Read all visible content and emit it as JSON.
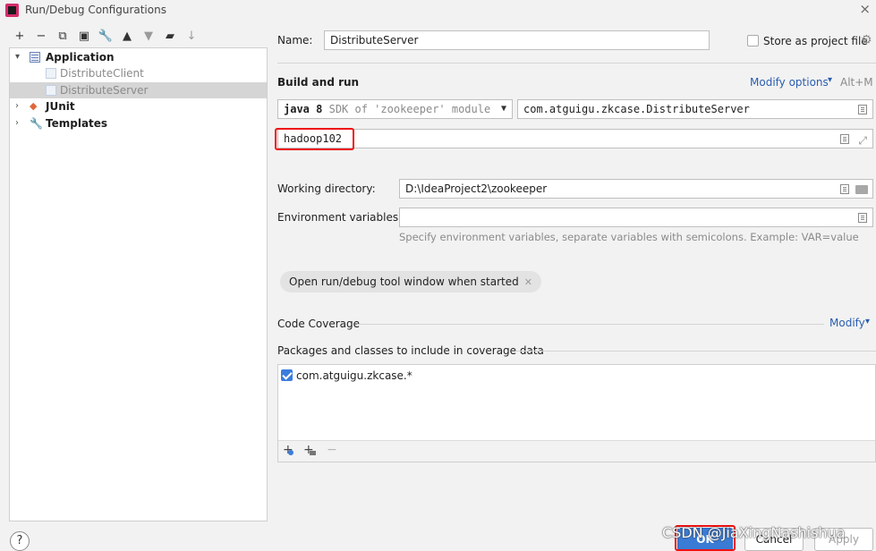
{
  "window": {
    "title": "Run/Debug Configurations",
    "close": "×"
  },
  "toolbar": {
    "add": "+",
    "remove": "−",
    "copy": "⧉",
    "save": "▣",
    "edit": "🔧",
    "up": "▲",
    "down": "▼",
    "folder": "▰",
    "sort": "↓"
  },
  "tree": {
    "application": "Application",
    "client": "DistributeClient",
    "server": "DistributeServer",
    "junit": "JUnit",
    "templates": "Templates"
  },
  "form": {
    "name_label": "Name:",
    "name_value": "DistributeServer",
    "store_label": "Store as project file",
    "build_run": "Build and run",
    "modify_options": "Modify options",
    "modify_shortcut": "Alt+M",
    "sdk_bold": "java 8",
    "sdk_rest": "SDK of 'zookeeper' module",
    "main_class": "com.atguigu.zkcase.DistributeServer",
    "program_args": "hadoop102",
    "working_dir_label": "Working directory:",
    "working_dir_value": "D:\\IdeaProject2\\zookeeper",
    "env_label": "Environment variables:",
    "env_hint": "Specify environment variables, separate variables with semicolons. Example: VAR=value",
    "chip": "Open run/debug tool window when started",
    "code_coverage": "Code Coverage",
    "modify": "Modify",
    "packages_label": "Packages and classes to include in coverage data",
    "package_item": "com.atguigu.zkcase.*"
  },
  "footer": {
    "help": "?",
    "ok": "OK",
    "cancel": "Cancel",
    "apply": "Apply",
    "watermark": "CSDN @JiaXingNashishua"
  }
}
